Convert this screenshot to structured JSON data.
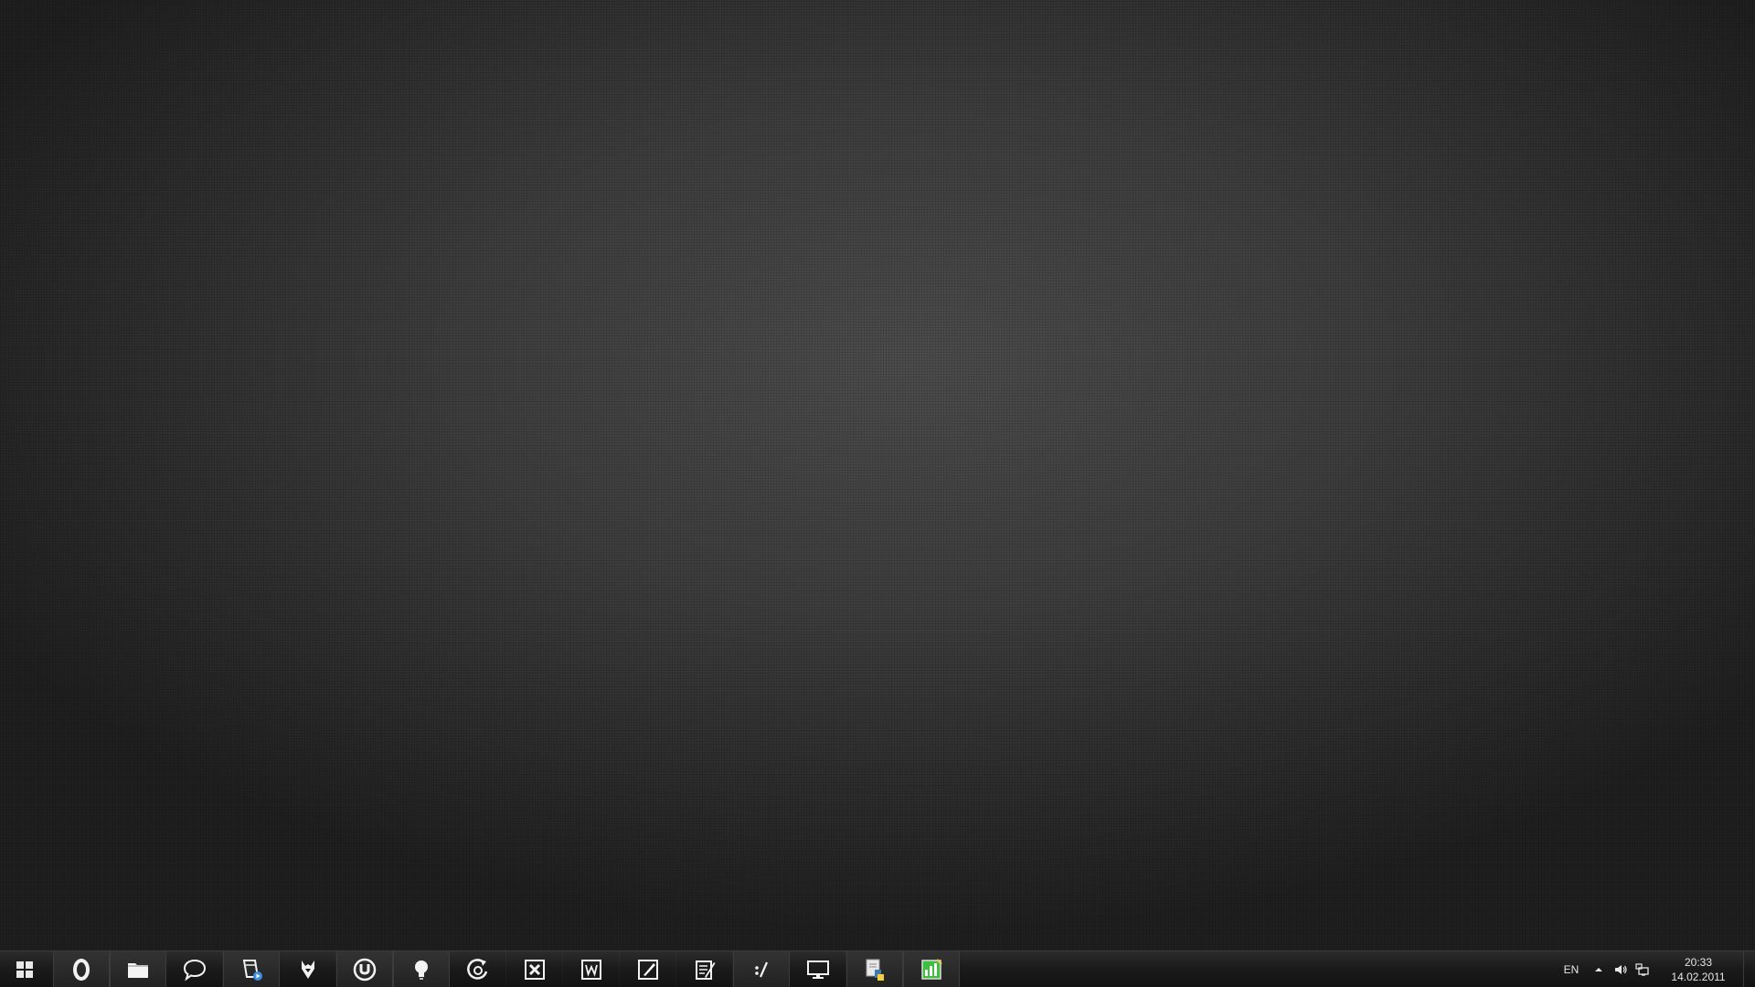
{
  "desktop": {},
  "taskbar": {
    "start_icon": "windows-logo-icon",
    "pinned": [
      {
        "name": "opera-button",
        "icon": "opera-icon"
      },
      {
        "name": "explorer-button",
        "icon": "folder-icon"
      },
      {
        "name": "chat-button",
        "icon": "speech-bubble-icon"
      },
      {
        "name": "media-player-button",
        "icon": "film-play-icon"
      },
      {
        "name": "fox-app-button",
        "icon": "fox-icon"
      },
      {
        "name": "utorrent-button",
        "icon": "utorrent-icon"
      },
      {
        "name": "lightbulb-app-button",
        "icon": "lightbulb-icon"
      },
      {
        "name": "sync-app-button",
        "icon": "sync-icon"
      },
      {
        "name": "excel-button",
        "icon": "excel-icon"
      },
      {
        "name": "word-button",
        "icon": "word-icon"
      },
      {
        "name": "paint-button",
        "icon": "paint-icon"
      },
      {
        "name": "notepad-button",
        "icon": "notepad-icon"
      },
      {
        "name": "command-button",
        "icon": "command-icon"
      },
      {
        "name": "remote-desktop-button",
        "icon": "monitor-icon"
      },
      {
        "name": "python-button",
        "icon": "python-icon"
      },
      {
        "name": "task-manager-button",
        "icon": "task-manager-icon"
      }
    ],
    "accent_color": "#67d9ea"
  },
  "tray": {
    "language": "EN",
    "icons": [
      "show-hidden-icons-icon",
      "volume-icon",
      "network-icon"
    ],
    "time": "20:33",
    "date": "14.02.2011"
  }
}
